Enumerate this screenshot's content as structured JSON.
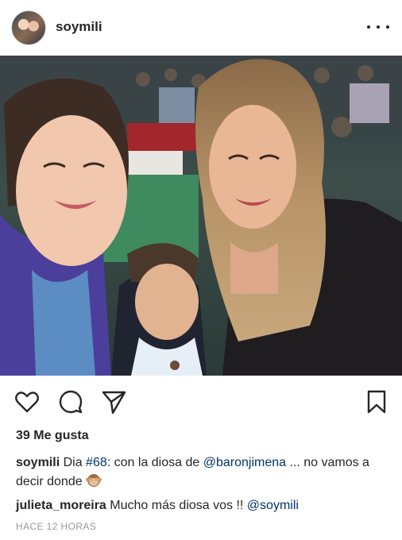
{
  "post": {
    "username": "soymili",
    "avatar_icon": "profile-avatar",
    "more_icon": "more-horizontal-icon"
  },
  "photo": {
    "icon": "selfie-photo"
  },
  "actions": {
    "like_icon": "heart-icon",
    "comment_icon": "comment-bubble-icon",
    "share_icon": "paper-plane-icon",
    "save_icon": "bookmark-icon"
  },
  "likes": {
    "text": "39 Me gusta"
  },
  "caption": {
    "user": "soymili",
    "text_1": " Dia ",
    "hashtag": "#68",
    "text_2": ": con la diosa de ",
    "mention": "@baronjimena",
    "text_3": " ... no vamos a decir donde ",
    "emoji": "see-no-evil-monkey"
  },
  "comment": {
    "user": "julieta_moreira",
    "text": " Mucho más diosa vos !! ",
    "mention": "@soymili"
  },
  "timestamp": "HACE 12 HORAS",
  "colors": {
    "text": "#262626",
    "link": "#003569",
    "muted": "#999999"
  }
}
